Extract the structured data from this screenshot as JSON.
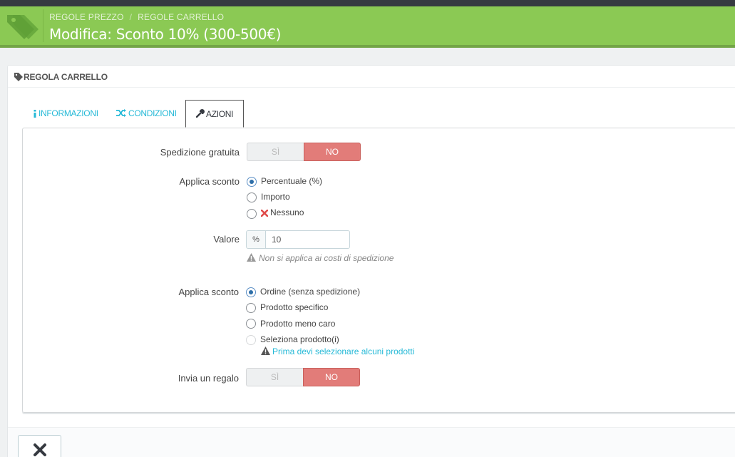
{
  "header": {
    "breadcrumb": [
      "REGOLE PREZZO",
      "REGOLE CARRELLO"
    ],
    "breadcrumb_sep": "/",
    "title": "Modifica: Sconto 10% (300-500€)",
    "icon": "tag-icon",
    "brand_color": "#8bc954"
  },
  "panel": {
    "heading": "REGOLA CARRELLO",
    "heading_icon": "tag-icon"
  },
  "tabs": [
    {
      "label": "INFORMAZIONI",
      "icon": "info-icon",
      "active": false
    },
    {
      "label": "CONDIZIONI",
      "icon": "random-icon",
      "active": false
    },
    {
      "label": "AZIONI",
      "icon": "wrench-icon",
      "active": true
    }
  ],
  "form": {
    "free_shipping": {
      "label": "Spedizione gratuita",
      "yes": "SÌ",
      "no": "NO",
      "value": "NO"
    },
    "apply_discount": {
      "label": "Applica sconto",
      "options": [
        {
          "label": "Percentuale (%)",
          "checked": true
        },
        {
          "label": "Importo",
          "checked": false
        },
        {
          "label": "Nessuno",
          "checked": false,
          "icon": "x-icon"
        }
      ]
    },
    "value": {
      "label": "Valore",
      "addon": "%",
      "value": "10",
      "help": "Non si applica ai costi di spedizione"
    },
    "apply_to": {
      "label": "Applica sconto",
      "options": [
        {
          "label": "Ordine (senza spedizione)",
          "checked": true
        },
        {
          "label": "Prodotto specifico",
          "checked": false
        },
        {
          "label": "Prodotto meno caro",
          "checked": false
        },
        {
          "label": "Seleziona prodotto(i)",
          "checked": false,
          "disabled": true
        }
      ],
      "warning": "Prima devi selezionare alcuni prodotti"
    },
    "gift": {
      "label": "Invia un regalo",
      "yes": "SÌ",
      "no": "NO",
      "value": "NO"
    }
  },
  "footer": {
    "cancel_icon": "close-icon"
  }
}
